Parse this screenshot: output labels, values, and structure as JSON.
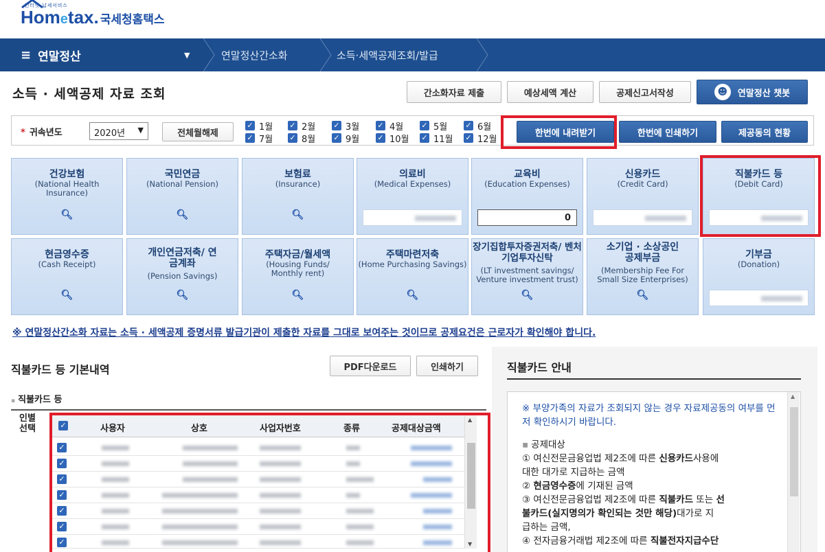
{
  "logo": {
    "small": "인터넷 납세서비스",
    "brand_a": "Hom",
    "brand_e": "e",
    "brand_b": "tax.",
    "brand_kr": "국세청홈택스"
  },
  "nav": {
    "main": "연말정산",
    "crumb1": "연말정산간소화",
    "crumb2": "소득·세액공제조회/발급"
  },
  "page_title": "소득 · 세액공제 자료 조회",
  "top_buttons": {
    "submit": "간소화자료 제출",
    "estimate": "예상세액 계산",
    "deduction": "공제신고서작성",
    "chatbot": "연말정산 챗봇"
  },
  "filter": {
    "label": "귀속년도",
    "year": "2020년",
    "deselect_all": "전체월해제",
    "months_top": [
      "1월",
      "2월",
      "3월",
      "4월",
      "5월",
      "6월"
    ],
    "months_bottom": [
      "7월",
      "8월",
      "9월",
      "10월",
      "11월",
      "12월"
    ],
    "download_all": "한번에 내려받기",
    "print_all": "한번에 인쇄하기",
    "consent_status": "제공동의 현황"
  },
  "categories_row1": [
    {
      "title": "건강보험",
      "en": "(National Health Insurance)"
    },
    {
      "title": "국민연금",
      "en": "(National Pension)"
    },
    {
      "title": "보험료",
      "en": "(Insurance)"
    },
    {
      "title": "의료비",
      "en": "(Medical Expenses)"
    },
    {
      "title": "교육비",
      "en": "(Education Expenses)",
      "amount": "0"
    },
    {
      "title": "신용카드",
      "en": "(Credit Card)"
    },
    {
      "title": "직불카드 등",
      "en": "(Debit Card)"
    }
  ],
  "categories_row2": [
    {
      "title": "현금영수증",
      "en": "(Cash Receipt)"
    },
    {
      "title": "개인연금저축/ 연금계좌",
      "en": "(Pension Savings)"
    },
    {
      "title": "주택자금/월세액",
      "en": "(Housing Funds/ Monthly rent)"
    },
    {
      "title": "주택마련저축",
      "en": "(Home Purchasing Savings)"
    },
    {
      "title": "장기집합투자증권저축/ 벤처기업투자신탁",
      "en": "(LT investment savings/ Venture investment trust)"
    },
    {
      "title": "소기업 · 소상공인 공제부금",
      "en": "(Membership Fee For Small Size Enterprises)"
    },
    {
      "title": "기부금",
      "en": "(Donation)"
    }
  ],
  "notice": "※ 연말정산간소화 자료는 소득 · 세액공제 증명서류 발급기관이 제출한 자료를 그대로 보여주는 것이므로 공제요건은 근로자가 확인해야 합니다.",
  "detail": {
    "title": "직불카드 등 기본내역",
    "pdf": "PDF다운로드",
    "print": "인쇄하기",
    "sub": "직불카드 등",
    "left_head": "인별 선택",
    "columns": [
      "사용자",
      "상호",
      "사업자번호",
      "종류",
      "공제대상금액"
    ],
    "row_count": 7
  },
  "guide": {
    "title": "직불카드 안내",
    "note": "※ 부양가족의 자료가 조회되지 않는 경우 자료제공동의 여부를 먼저 확인하시기 바랍니다.",
    "bullet": "공제대상",
    "l1a": "① 여신전문금융업법 제2조에 따른 ",
    "l1b": "신용카드",
    "l1c": "사용에",
    "l2": "대한 대가로 지급하는 금액",
    "l3a": "② ",
    "l3b": "현금영수증",
    "l3c": "에 기재된 금액",
    "l4a": "③ 여신전문금융업법 제2조에 따른 ",
    "l4b": "직불카드",
    "l4c": " 또는 ",
    "l4d": "선",
    "l5a": "불카드(실지명의가 확인되는 것만 해당)",
    "l5b": "대가로 지",
    "l6": "급하는 금액,",
    "l7a": "④ 전자금융거래법 제2조에 따른 ",
    "l7b": "직불전자지급수단"
  },
  "colors": {
    "nav": "#1d4e8f",
    "accent": "#2a5a9c",
    "highlight": "#e01d2a",
    "tile": "#d4e3f5"
  },
  "icons": [
    "menu-icon",
    "chevron-down-icon",
    "chatbot-icon",
    "search-icon",
    "checkbox-icon"
  ]
}
